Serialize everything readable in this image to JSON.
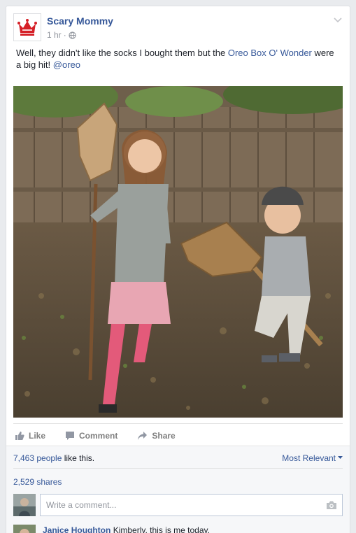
{
  "post": {
    "page_name": "Scary Mommy",
    "time": "1 hr",
    "separator": "·",
    "audience_icon": "globe-icon",
    "text_before": "Well, they didn't like the socks I bought them but the ",
    "link_text": "Oreo Box O' Wonder",
    "text_middle": " were a big hit! ",
    "mention": "@oreo"
  },
  "actions": {
    "like": "Like",
    "comment": "Comment",
    "share": "Share"
  },
  "feedback": {
    "likes_link": "7,463 people",
    "likes_suffix": " like this.",
    "sort_label": "Most Relevant",
    "shares": "2,529 shares",
    "comment_placeholder": "Write a comment..."
  },
  "comments": [
    {
      "author": "Janice Houghton",
      "text": "Kimberly, this is me today."
    }
  ],
  "colors": {
    "link": "#365899",
    "background": "#e9ebee",
    "logo_red": "#d52027"
  }
}
